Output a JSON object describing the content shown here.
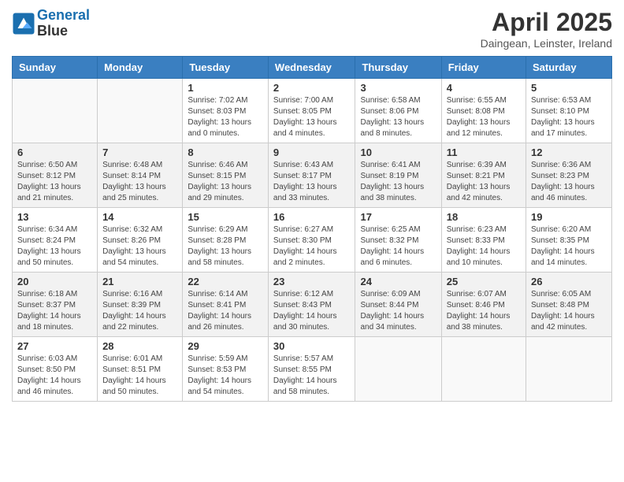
{
  "header": {
    "logo_line1": "General",
    "logo_line2": "Blue",
    "month": "April 2025",
    "location": "Daingean, Leinster, Ireland"
  },
  "weekdays": [
    "Sunday",
    "Monday",
    "Tuesday",
    "Wednesday",
    "Thursday",
    "Friday",
    "Saturday"
  ],
  "weeks": [
    [
      {
        "day": "",
        "info": ""
      },
      {
        "day": "",
        "info": ""
      },
      {
        "day": "1",
        "info": "Sunrise: 7:02 AM\nSunset: 8:03 PM\nDaylight: 13 hours\nand 0 minutes."
      },
      {
        "day": "2",
        "info": "Sunrise: 7:00 AM\nSunset: 8:05 PM\nDaylight: 13 hours\nand 4 minutes."
      },
      {
        "day": "3",
        "info": "Sunrise: 6:58 AM\nSunset: 8:06 PM\nDaylight: 13 hours\nand 8 minutes."
      },
      {
        "day": "4",
        "info": "Sunrise: 6:55 AM\nSunset: 8:08 PM\nDaylight: 13 hours\nand 12 minutes."
      },
      {
        "day": "5",
        "info": "Sunrise: 6:53 AM\nSunset: 8:10 PM\nDaylight: 13 hours\nand 17 minutes."
      }
    ],
    [
      {
        "day": "6",
        "info": "Sunrise: 6:50 AM\nSunset: 8:12 PM\nDaylight: 13 hours\nand 21 minutes."
      },
      {
        "day": "7",
        "info": "Sunrise: 6:48 AM\nSunset: 8:14 PM\nDaylight: 13 hours\nand 25 minutes."
      },
      {
        "day": "8",
        "info": "Sunrise: 6:46 AM\nSunset: 8:15 PM\nDaylight: 13 hours\nand 29 minutes."
      },
      {
        "day": "9",
        "info": "Sunrise: 6:43 AM\nSunset: 8:17 PM\nDaylight: 13 hours\nand 33 minutes."
      },
      {
        "day": "10",
        "info": "Sunrise: 6:41 AM\nSunset: 8:19 PM\nDaylight: 13 hours\nand 38 minutes."
      },
      {
        "day": "11",
        "info": "Sunrise: 6:39 AM\nSunset: 8:21 PM\nDaylight: 13 hours\nand 42 minutes."
      },
      {
        "day": "12",
        "info": "Sunrise: 6:36 AM\nSunset: 8:23 PM\nDaylight: 13 hours\nand 46 minutes."
      }
    ],
    [
      {
        "day": "13",
        "info": "Sunrise: 6:34 AM\nSunset: 8:24 PM\nDaylight: 13 hours\nand 50 minutes."
      },
      {
        "day": "14",
        "info": "Sunrise: 6:32 AM\nSunset: 8:26 PM\nDaylight: 13 hours\nand 54 minutes."
      },
      {
        "day": "15",
        "info": "Sunrise: 6:29 AM\nSunset: 8:28 PM\nDaylight: 13 hours\nand 58 minutes."
      },
      {
        "day": "16",
        "info": "Sunrise: 6:27 AM\nSunset: 8:30 PM\nDaylight: 14 hours\nand 2 minutes."
      },
      {
        "day": "17",
        "info": "Sunrise: 6:25 AM\nSunset: 8:32 PM\nDaylight: 14 hours\nand 6 minutes."
      },
      {
        "day": "18",
        "info": "Sunrise: 6:23 AM\nSunset: 8:33 PM\nDaylight: 14 hours\nand 10 minutes."
      },
      {
        "day": "19",
        "info": "Sunrise: 6:20 AM\nSunset: 8:35 PM\nDaylight: 14 hours\nand 14 minutes."
      }
    ],
    [
      {
        "day": "20",
        "info": "Sunrise: 6:18 AM\nSunset: 8:37 PM\nDaylight: 14 hours\nand 18 minutes."
      },
      {
        "day": "21",
        "info": "Sunrise: 6:16 AM\nSunset: 8:39 PM\nDaylight: 14 hours\nand 22 minutes."
      },
      {
        "day": "22",
        "info": "Sunrise: 6:14 AM\nSunset: 8:41 PM\nDaylight: 14 hours\nand 26 minutes."
      },
      {
        "day": "23",
        "info": "Sunrise: 6:12 AM\nSunset: 8:43 PM\nDaylight: 14 hours\nand 30 minutes."
      },
      {
        "day": "24",
        "info": "Sunrise: 6:09 AM\nSunset: 8:44 PM\nDaylight: 14 hours\nand 34 minutes."
      },
      {
        "day": "25",
        "info": "Sunrise: 6:07 AM\nSunset: 8:46 PM\nDaylight: 14 hours\nand 38 minutes."
      },
      {
        "day": "26",
        "info": "Sunrise: 6:05 AM\nSunset: 8:48 PM\nDaylight: 14 hours\nand 42 minutes."
      }
    ],
    [
      {
        "day": "27",
        "info": "Sunrise: 6:03 AM\nSunset: 8:50 PM\nDaylight: 14 hours\nand 46 minutes."
      },
      {
        "day": "28",
        "info": "Sunrise: 6:01 AM\nSunset: 8:51 PM\nDaylight: 14 hours\nand 50 minutes."
      },
      {
        "day": "29",
        "info": "Sunrise: 5:59 AM\nSunset: 8:53 PM\nDaylight: 14 hours\nand 54 minutes."
      },
      {
        "day": "30",
        "info": "Sunrise: 5:57 AM\nSunset: 8:55 PM\nDaylight: 14 hours\nand 58 minutes."
      },
      {
        "day": "",
        "info": ""
      },
      {
        "day": "",
        "info": ""
      },
      {
        "day": "",
        "info": ""
      }
    ]
  ]
}
